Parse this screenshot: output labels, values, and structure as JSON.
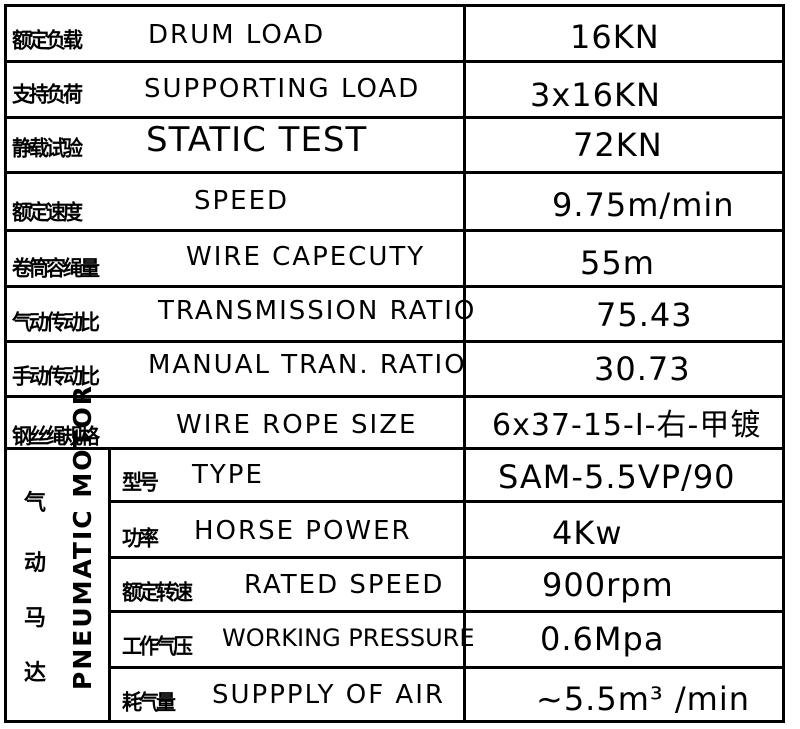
{
  "rows": [
    {
      "cn": "额定负载",
      "en": "DRUM LOAD",
      "value": "16KN"
    },
    {
      "cn": "支持负荷",
      "en": "SUPPORTING LOAD",
      "value": "3x16KN"
    },
    {
      "cn": "静载试验",
      "en": "STATIC TEST",
      "value": "72KN"
    },
    {
      "cn": "额定速度",
      "en": "SPEED",
      "value": "9.75m/min"
    },
    {
      "cn": "卷筒容绳量",
      "en": "WIRE CAPECUTY",
      "value": "55m"
    },
    {
      "cn": "气动传动比",
      "en": "TRANSMISSION RATIO",
      "value": "75.43"
    },
    {
      "cn": "手动传动比",
      "en": "MANUAL TRAN. RATIO",
      "value": "30.73"
    },
    {
      "cn": "钢丝绳规格",
      "en": "WIRE ROPE SIZE",
      "value": "6x37-15-I-右-甲镀"
    }
  ],
  "motor": {
    "cn_label": [
      "气",
      "动",
      "马",
      "达"
    ],
    "en_label": "PNEUMATIC MOTOR",
    "rows": [
      {
        "cn": "型号",
        "en": "TYPE",
        "value": "SAM-5.5VP/90"
      },
      {
        "cn": "功率",
        "en": "HORSE POWER",
        "value": "4Kw"
      },
      {
        "cn": "额定转速",
        "en": "RATED SPEED",
        "value": "900rpm"
      },
      {
        "cn": "工作气压",
        "en": "WORKING PRESSURE",
        "value": "0.6Mpa"
      },
      {
        "cn": "耗气量",
        "en": "SUPPPLY OF AIR",
        "value": "~5.5m³ /min"
      }
    ]
  }
}
